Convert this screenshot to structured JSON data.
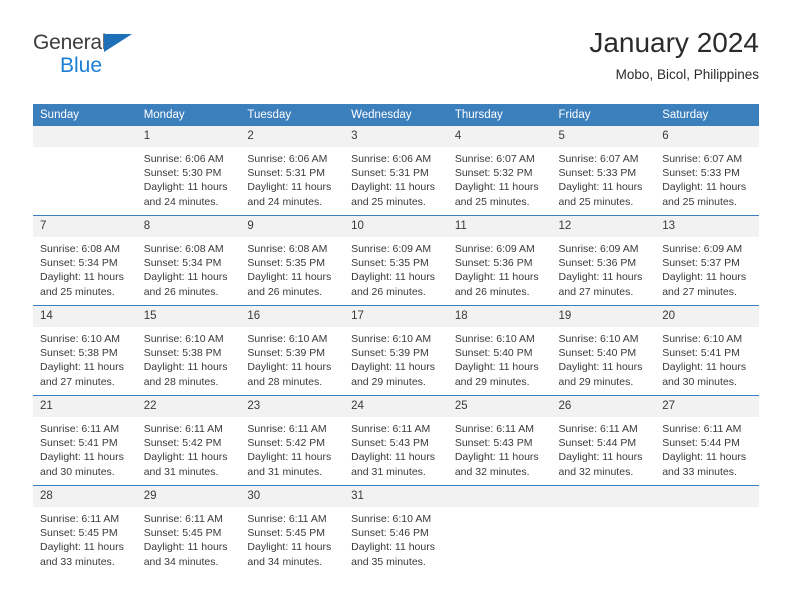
{
  "brand": {
    "name_part1": "General",
    "name_part2": "Blue",
    "triangle_color": "#1d6fb8",
    "part2_color": "#1b7fd4"
  },
  "header": {
    "title": "January 2024",
    "subtitle": "Mobo, Bicol, Philippines"
  },
  "theme": {
    "header_bg": "#3c7fbd",
    "header_text": "#ffffff",
    "daynum_bg": "#f2f2f2",
    "row_divider": "#3c7fbd",
    "body_text": "#3a3a3a"
  },
  "weekday_headers": [
    "Sunday",
    "Monday",
    "Tuesday",
    "Wednesday",
    "Thursday",
    "Friday",
    "Saturday"
  ],
  "labels": {
    "sunrise_prefix": "Sunrise:",
    "sunset_prefix": "Sunset:",
    "daylight_prefix": "Daylight:"
  },
  "weeks": [
    [
      {
        "day": "",
        "sunrise": "",
        "sunset": "",
        "daylight_line1": "",
        "daylight_line2": ""
      },
      {
        "day": "1",
        "sunrise": "Sunrise: 6:06 AM",
        "sunset": "Sunset: 5:30 PM",
        "daylight_line1": "Daylight: 11 hours",
        "daylight_line2": "and 24 minutes."
      },
      {
        "day": "2",
        "sunrise": "Sunrise: 6:06 AM",
        "sunset": "Sunset: 5:31 PM",
        "daylight_line1": "Daylight: 11 hours",
        "daylight_line2": "and 24 minutes."
      },
      {
        "day": "3",
        "sunrise": "Sunrise: 6:06 AM",
        "sunset": "Sunset: 5:31 PM",
        "daylight_line1": "Daylight: 11 hours",
        "daylight_line2": "and 25 minutes."
      },
      {
        "day": "4",
        "sunrise": "Sunrise: 6:07 AM",
        "sunset": "Sunset: 5:32 PM",
        "daylight_line1": "Daylight: 11 hours",
        "daylight_line2": "and 25 minutes."
      },
      {
        "day": "5",
        "sunrise": "Sunrise: 6:07 AM",
        "sunset": "Sunset: 5:33 PM",
        "daylight_line1": "Daylight: 11 hours",
        "daylight_line2": "and 25 minutes."
      },
      {
        "day": "6",
        "sunrise": "Sunrise: 6:07 AM",
        "sunset": "Sunset: 5:33 PM",
        "daylight_line1": "Daylight: 11 hours",
        "daylight_line2": "and 25 minutes."
      }
    ],
    [
      {
        "day": "7",
        "sunrise": "Sunrise: 6:08 AM",
        "sunset": "Sunset: 5:34 PM",
        "daylight_line1": "Daylight: 11 hours",
        "daylight_line2": "and 25 minutes."
      },
      {
        "day": "8",
        "sunrise": "Sunrise: 6:08 AM",
        "sunset": "Sunset: 5:34 PM",
        "daylight_line1": "Daylight: 11 hours",
        "daylight_line2": "and 26 minutes."
      },
      {
        "day": "9",
        "sunrise": "Sunrise: 6:08 AM",
        "sunset": "Sunset: 5:35 PM",
        "daylight_line1": "Daylight: 11 hours",
        "daylight_line2": "and 26 minutes."
      },
      {
        "day": "10",
        "sunrise": "Sunrise: 6:09 AM",
        "sunset": "Sunset: 5:35 PM",
        "daylight_line1": "Daylight: 11 hours",
        "daylight_line2": "and 26 minutes."
      },
      {
        "day": "11",
        "sunrise": "Sunrise: 6:09 AM",
        "sunset": "Sunset: 5:36 PM",
        "daylight_line1": "Daylight: 11 hours",
        "daylight_line2": "and 26 minutes."
      },
      {
        "day": "12",
        "sunrise": "Sunrise: 6:09 AM",
        "sunset": "Sunset: 5:36 PM",
        "daylight_line1": "Daylight: 11 hours",
        "daylight_line2": "and 27 minutes."
      },
      {
        "day": "13",
        "sunrise": "Sunrise: 6:09 AM",
        "sunset": "Sunset: 5:37 PM",
        "daylight_line1": "Daylight: 11 hours",
        "daylight_line2": "and 27 minutes."
      }
    ],
    [
      {
        "day": "14",
        "sunrise": "Sunrise: 6:10 AM",
        "sunset": "Sunset: 5:38 PM",
        "daylight_line1": "Daylight: 11 hours",
        "daylight_line2": "and 27 minutes."
      },
      {
        "day": "15",
        "sunrise": "Sunrise: 6:10 AM",
        "sunset": "Sunset: 5:38 PM",
        "daylight_line1": "Daylight: 11 hours",
        "daylight_line2": "and 28 minutes."
      },
      {
        "day": "16",
        "sunrise": "Sunrise: 6:10 AM",
        "sunset": "Sunset: 5:39 PM",
        "daylight_line1": "Daylight: 11 hours",
        "daylight_line2": "and 28 minutes."
      },
      {
        "day": "17",
        "sunrise": "Sunrise: 6:10 AM",
        "sunset": "Sunset: 5:39 PM",
        "daylight_line1": "Daylight: 11 hours",
        "daylight_line2": "and 29 minutes."
      },
      {
        "day": "18",
        "sunrise": "Sunrise: 6:10 AM",
        "sunset": "Sunset: 5:40 PM",
        "daylight_line1": "Daylight: 11 hours",
        "daylight_line2": "and 29 minutes."
      },
      {
        "day": "19",
        "sunrise": "Sunrise: 6:10 AM",
        "sunset": "Sunset: 5:40 PM",
        "daylight_line1": "Daylight: 11 hours",
        "daylight_line2": "and 29 minutes."
      },
      {
        "day": "20",
        "sunrise": "Sunrise: 6:10 AM",
        "sunset": "Sunset: 5:41 PM",
        "daylight_line1": "Daylight: 11 hours",
        "daylight_line2": "and 30 minutes."
      }
    ],
    [
      {
        "day": "21",
        "sunrise": "Sunrise: 6:11 AM",
        "sunset": "Sunset: 5:41 PM",
        "daylight_line1": "Daylight: 11 hours",
        "daylight_line2": "and 30 minutes."
      },
      {
        "day": "22",
        "sunrise": "Sunrise: 6:11 AM",
        "sunset": "Sunset: 5:42 PM",
        "daylight_line1": "Daylight: 11 hours",
        "daylight_line2": "and 31 minutes."
      },
      {
        "day": "23",
        "sunrise": "Sunrise: 6:11 AM",
        "sunset": "Sunset: 5:42 PM",
        "daylight_line1": "Daylight: 11 hours",
        "daylight_line2": "and 31 minutes."
      },
      {
        "day": "24",
        "sunrise": "Sunrise: 6:11 AM",
        "sunset": "Sunset: 5:43 PM",
        "daylight_line1": "Daylight: 11 hours",
        "daylight_line2": "and 31 minutes."
      },
      {
        "day": "25",
        "sunrise": "Sunrise: 6:11 AM",
        "sunset": "Sunset: 5:43 PM",
        "daylight_line1": "Daylight: 11 hours",
        "daylight_line2": "and 32 minutes."
      },
      {
        "day": "26",
        "sunrise": "Sunrise: 6:11 AM",
        "sunset": "Sunset: 5:44 PM",
        "daylight_line1": "Daylight: 11 hours",
        "daylight_line2": "and 32 minutes."
      },
      {
        "day": "27",
        "sunrise": "Sunrise: 6:11 AM",
        "sunset": "Sunset: 5:44 PM",
        "daylight_line1": "Daylight: 11 hours",
        "daylight_line2": "and 33 minutes."
      }
    ],
    [
      {
        "day": "28",
        "sunrise": "Sunrise: 6:11 AM",
        "sunset": "Sunset: 5:45 PM",
        "daylight_line1": "Daylight: 11 hours",
        "daylight_line2": "and 33 minutes."
      },
      {
        "day": "29",
        "sunrise": "Sunrise: 6:11 AM",
        "sunset": "Sunset: 5:45 PM",
        "daylight_line1": "Daylight: 11 hours",
        "daylight_line2": "and 34 minutes."
      },
      {
        "day": "30",
        "sunrise": "Sunrise: 6:11 AM",
        "sunset": "Sunset: 5:45 PM",
        "daylight_line1": "Daylight: 11 hours",
        "daylight_line2": "and 34 minutes."
      },
      {
        "day": "31",
        "sunrise": "Sunrise: 6:10 AM",
        "sunset": "Sunset: 5:46 PM",
        "daylight_line1": "Daylight: 11 hours",
        "daylight_line2": "and 35 minutes."
      },
      {
        "day": "",
        "sunrise": "",
        "sunset": "",
        "daylight_line1": "",
        "daylight_line2": ""
      },
      {
        "day": "",
        "sunrise": "",
        "sunset": "",
        "daylight_line1": "",
        "daylight_line2": ""
      },
      {
        "day": "",
        "sunrise": "",
        "sunset": "",
        "daylight_line1": "",
        "daylight_line2": ""
      }
    ]
  ]
}
